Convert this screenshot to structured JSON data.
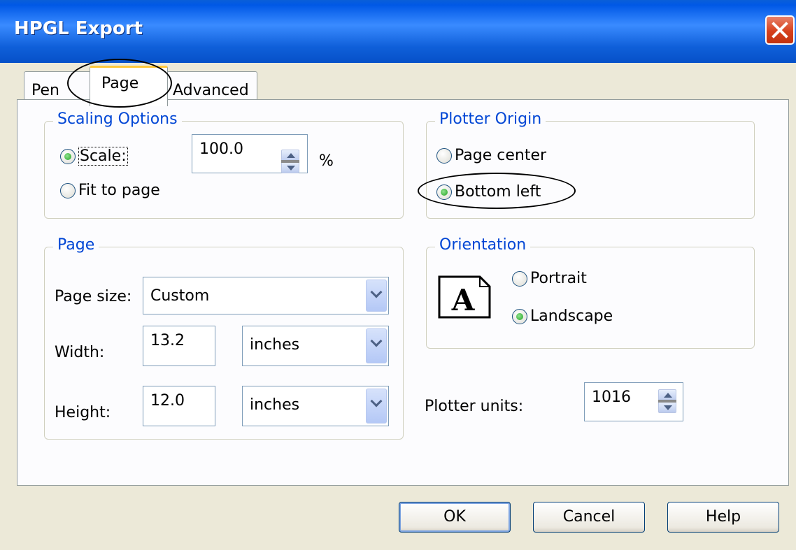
{
  "window": {
    "title": "HPGL Export"
  },
  "tabs": [
    {
      "label": "Pen",
      "active": false
    },
    {
      "label": "Page",
      "active": true
    },
    {
      "label": "Advanced",
      "active": false
    }
  ],
  "scaling": {
    "title": "Scaling Options",
    "scale_label": "Scale:",
    "scale_value": "100.0",
    "percent": "%",
    "fit_label": "Fit to page",
    "selected": "scale"
  },
  "plotter_origin": {
    "title": "Plotter Origin",
    "page_center": "Page center",
    "bottom_left": "Bottom left",
    "selected": "bottom_left"
  },
  "page": {
    "title": "Page",
    "size_label": "Page size:",
    "size_value": "Custom",
    "width_label": "Width:",
    "width_value": "13.2",
    "width_units": "inches",
    "height_label": "Height:",
    "height_value": "12.0",
    "height_units": "inches"
  },
  "orientation": {
    "title": "Orientation",
    "portrait": "Portrait",
    "landscape": "Landscape",
    "selected": "landscape",
    "icon_letter": "A"
  },
  "plotter_units": {
    "label": "Plotter units:",
    "value": "1016"
  },
  "buttons": {
    "ok": "OK",
    "cancel": "Cancel",
    "help": "Help"
  },
  "colors": {
    "titlebar": "#0058e6",
    "group_title": "#0046d5",
    "tab_highlight": "#ffc83c",
    "dialog_bg": "#ece9d8"
  }
}
